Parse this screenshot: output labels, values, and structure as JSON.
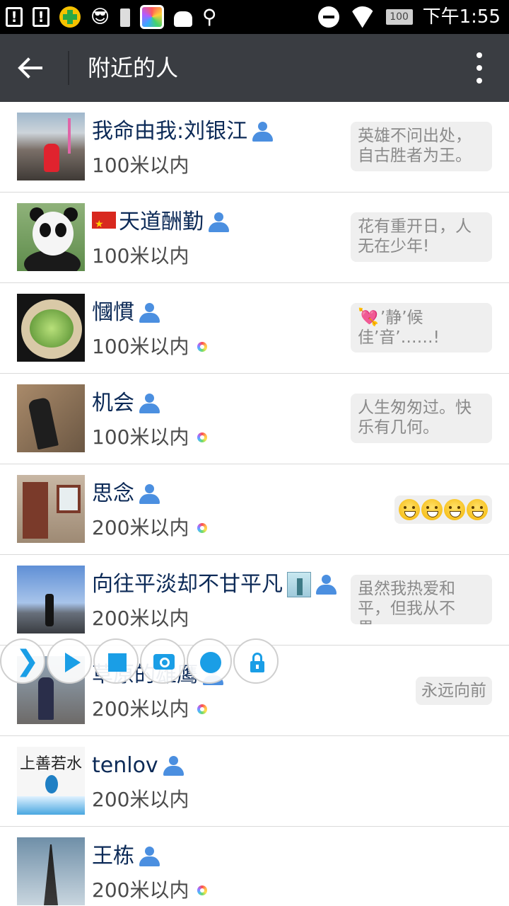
{
  "status_bar": {
    "time": "下午1:55",
    "battery_level": "100",
    "icons": [
      "alert-card-icon",
      "alert-card-icon",
      "assistant-plus-icon",
      "glasses-icon",
      "battery-small-icon",
      "colorful-app-icon",
      "android-icon",
      "usb-icon",
      "do-not-disturb-icon",
      "wifi-icon",
      "battery-icon"
    ]
  },
  "header": {
    "title": "附近的人",
    "back_icon": "back-arrow-icon",
    "menu_icon": "more-vert-icon"
  },
  "people": [
    {
      "name": "我命由我:刘银江",
      "distance": "100米以内",
      "signature": "英雄不问出处，自古胜者为王。",
      "moments": false
    },
    {
      "name": "天道酬勤",
      "distance": "100米以内",
      "signature": "花有重开日，人无在少年!",
      "moments": false,
      "prefix_icon": "china-flag-icon"
    },
    {
      "name": "慖慣",
      "distance": "100米以内",
      "signature": "’静’候佳’音’……!",
      "moments": true,
      "signature_prefix": "💘"
    },
    {
      "name": "机会",
      "distance": "100米以内",
      "signature": "人生匆匆过。快乐有几何。",
      "moments": true
    },
    {
      "name": "思念",
      "distance": "200米以内",
      "signature_emoji": [
        "grin",
        "smile",
        "grin",
        "smile"
      ],
      "moments": true
    },
    {
      "name": "向往平淡却不甘平凡",
      "distance": "200米以内",
      "signature": "虽然我热爱和平，但我从不畏...",
      "moments": false,
      "suffix_icon": "statue-of-liberty-icon"
    },
    {
      "name": "草原的雄鹰",
      "distance": "200米以内",
      "signature": "永远向前",
      "moments": true
    },
    {
      "name": "tenlov",
      "distance": "200米以内",
      "moments": false,
      "avatar_text": "上善若水"
    },
    {
      "name": "王栋",
      "distance": "200米以内",
      "moments": true
    }
  ],
  "control_bar": {
    "buttons": [
      "expand-chevron-icon",
      "play-icon",
      "stop-icon",
      "camera-icon",
      "record-icon",
      "unlock-icon"
    ]
  }
}
